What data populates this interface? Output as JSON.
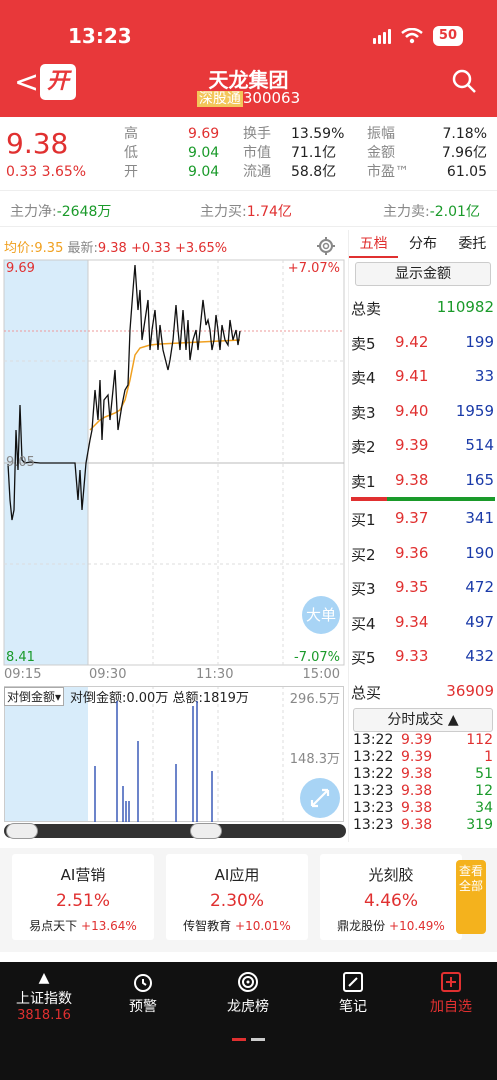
{
  "status_bar": {
    "time": "13:23",
    "battery": "50"
  },
  "header": {
    "logo": "开",
    "name": "天龙集团",
    "market_tag": "深股通",
    "code": "300063"
  },
  "quote": {
    "price": "9.38",
    "change": "0.33",
    "change_pct": "3.65%",
    "high_label": "高",
    "high": "9.69",
    "low_label": "低",
    "low": "9.04",
    "open_label": "开",
    "open": "9.04",
    "turnover_label": "换手",
    "turnover": "13.59%",
    "mcap_label": "市值",
    "mcap": "71.1亿",
    "float_label": "流通",
    "float": "58.8亿",
    "amp_label": "振幅",
    "amp": "7.18%",
    "amount_label": "金额",
    "amount": "7.96亿",
    "pe_label": "市盈™",
    "pe": "61.05"
  },
  "flow": {
    "net_label": "主力净:",
    "net": "-2648万",
    "buy_label": "主力买:",
    "buy": "1.74亿",
    "sell_label": "主力卖:",
    "sell": "-2.01亿"
  },
  "chart": {
    "avg_label": "均价:",
    "avg": "9.35",
    "latest_label": "最新:",
    "latest": "9.38",
    "latest_chg": "+0.33",
    "latest_pct": "+3.65%",
    "y_top": "9.69",
    "y_top_pct": "+7.07%",
    "y_bottom": "8.41",
    "y_bottom_pct": "-7.07%",
    "mid_label": "9.05",
    "times": [
      "09:15",
      "09:30",
      "11:30",
      "15:00"
    ],
    "big_btn": "大单",
    "vol_dropdown": "对倒金额",
    "vol_info": "对倒金额:0.00万 总额:1819万",
    "vol_top": "296.5万",
    "vol_mid": "148.3万"
  },
  "chart_data": {
    "type": "line",
    "x": [
      "09:15",
      "09:30",
      "11:30",
      "15:00"
    ],
    "ylim": [
      8.41,
      9.69
    ],
    "price_last": 9.38,
    "avg_last": 9.35
  },
  "side": {
    "tabs": [
      "五档",
      "分布",
      "委托"
    ],
    "show_amount": "显示金额",
    "total_sell_label": "总卖",
    "total_sell": "110982",
    "asks": [
      {
        "l": "卖5",
        "p": "9.42",
        "v": "199"
      },
      {
        "l": "卖4",
        "p": "9.41",
        "v": "33"
      },
      {
        "l": "卖3",
        "p": "9.40",
        "v": "1959"
      },
      {
        "l": "卖2",
        "p": "9.39",
        "v": "514"
      },
      {
        "l": "卖1",
        "p": "9.38",
        "v": "165"
      }
    ],
    "bids": [
      {
        "l": "买1",
        "p": "9.37",
        "v": "341"
      },
      {
        "l": "买2",
        "p": "9.36",
        "v": "190"
      },
      {
        "l": "买3",
        "p": "9.35",
        "v": "472"
      },
      {
        "l": "买4",
        "p": "9.34",
        "v": "497"
      },
      {
        "l": "买5",
        "p": "9.33",
        "v": "432"
      }
    ],
    "total_buy_label": "总买",
    "total_buy": "36909",
    "ticks_btn": "分时成交",
    "ticks": [
      {
        "t": "13:22",
        "p": "9.39",
        "v": "112"
      },
      {
        "t": "13:22",
        "p": "9.39",
        "v": "1"
      },
      {
        "t": "13:22",
        "p": "9.38",
        "v": "51"
      },
      {
        "t": "13:23",
        "p": "9.38",
        "v": "12"
      },
      {
        "t": "13:23",
        "p": "9.38",
        "v": "34"
      },
      {
        "t": "13:23",
        "p": "9.38",
        "v": "319"
      }
    ]
  },
  "cards": [
    {
      "t": "AI营销",
      "p": "2.51%",
      "s": "易点天下",
      "sp": "+13.64%"
    },
    {
      "t": "AI应用",
      "p": "2.30%",
      "s": "传智教育",
      "sp": "+10.01%"
    },
    {
      "t": "光刻胶",
      "p": "4.46%",
      "s": "鼎龙股份",
      "sp": "+10.49%"
    }
  ],
  "view_all": "查看全部",
  "tabbar": {
    "index_name": "上证指数",
    "index_val": "3818.16",
    "items": [
      "预警",
      "龙虎榜",
      "笔记",
      "加自选"
    ]
  }
}
